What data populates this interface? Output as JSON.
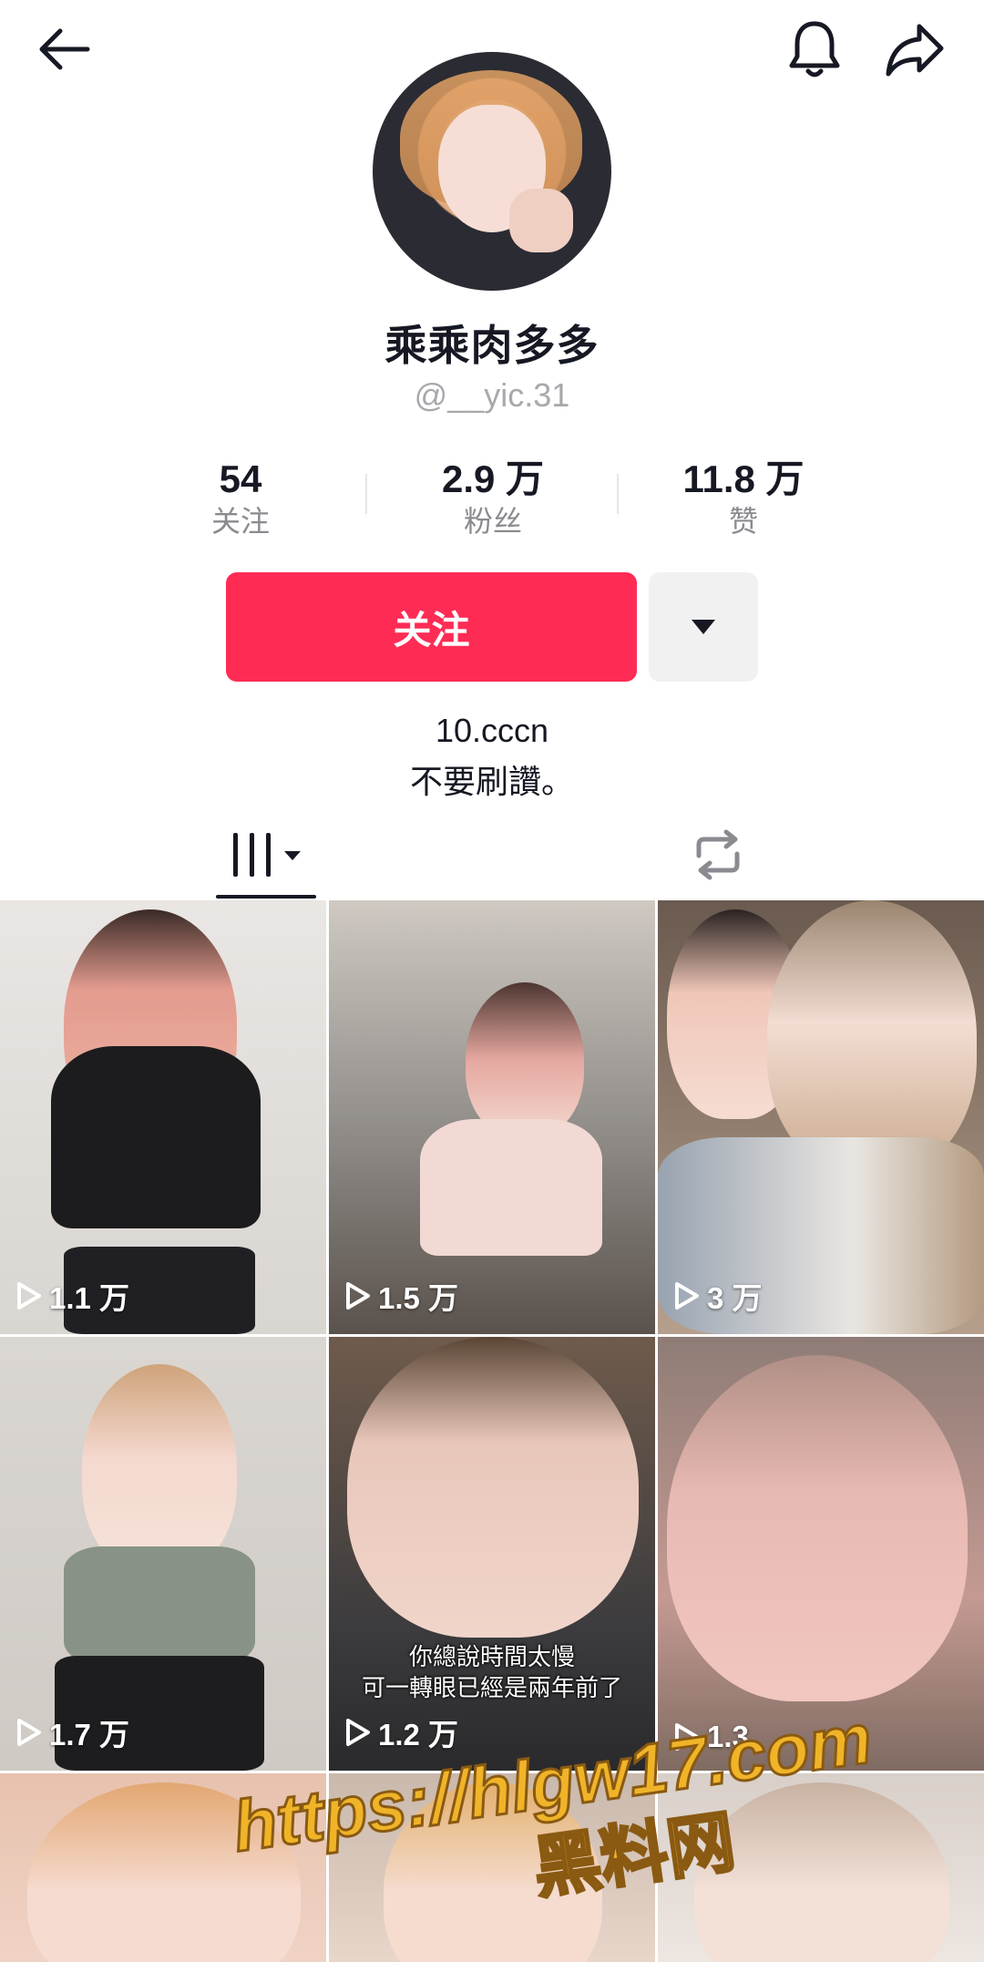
{
  "profile": {
    "display_name": "乘乘肉多多",
    "username": "@__yic.31"
  },
  "stats": {
    "following": {
      "value": "54",
      "label": "关注"
    },
    "followers": {
      "value": "2.9 万",
      "label": "粉丝"
    },
    "likes": {
      "value": "11.8 万",
      "label": "赞"
    }
  },
  "actions": {
    "follow_label": "关注"
  },
  "bio": {
    "line1": "10.cccn",
    "line2": "不要刷讚。"
  },
  "icons": {
    "back": "back-arrow-icon",
    "bell": "bell-icon",
    "share": "share-icon",
    "videos_tab": "video-grid-icon",
    "reposts_tab": "repost-icon",
    "play": "play-icon"
  },
  "videos": [
    {
      "views": "1.1 万",
      "caption": ""
    },
    {
      "views": "1.5 万",
      "caption": ""
    },
    {
      "views": "3 万",
      "caption": ""
    },
    {
      "views": "1.7 万",
      "caption": ""
    },
    {
      "views": "1.2 万",
      "caption": "你總說時間太慢\n可一轉眼已經是兩年前了"
    },
    {
      "views": "1.3",
      "caption": ""
    },
    {
      "views": "",
      "caption": ""
    },
    {
      "views": "",
      "caption": ""
    },
    {
      "views": "",
      "caption": ""
    }
  ],
  "watermark": {
    "url_text": "https://hlgw17.com",
    "site_text": "黑料网"
  },
  "colors": {
    "accent": "#fe2c55",
    "text_primary": "#161823",
    "text_secondary": "#8a8b91",
    "handle": "#a8a8ad"
  }
}
